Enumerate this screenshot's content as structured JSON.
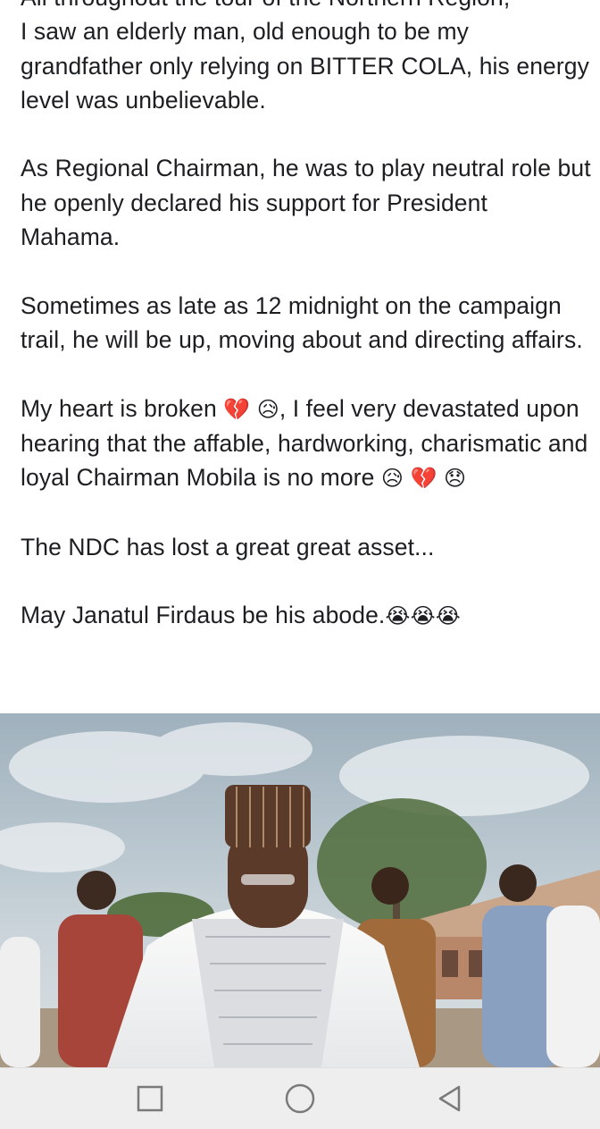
{
  "post": {
    "line_top": "All throughout the tour of the Northern Region,",
    "para1_rest": "I saw an elderly man, old enough to be my grandfather only relying on BITTER COLA, his energy level was unbelievable.",
    "para2": "As Regional Chairman, he was to play neutral role but he openly declared his support for President Mahama.",
    "para3": "Sometimes as late as 12 midnight on the campaign trail, he will be up, moving about and directing affairs.",
    "para4_start": "My heart is broken",
    "para4_mid": ", I feel very devastated upon hearing that the affable, hardworking, charismatic and loyal Chairman Mobila is no more",
    "para5": "The NDC has lost a great great asset...",
    "para6": "May Janatul Firdaus be his abode.",
    "emoji": {
      "broken_heart": "💔",
      "sad_sweat": "😥",
      "pensive": "😞",
      "loud_cry": "😭"
    }
  },
  "photo": {
    "subject": "elderly man in white embroidered smock and striped cap with people standing behind",
    "colors": {
      "sky": "#b8c6cf",
      "robe": "#f4f4f2",
      "cap": "#5a3a28",
      "skin": "#5b3a2a"
    }
  },
  "nav": {
    "recents_icon": "square-icon",
    "home_icon": "circle-icon",
    "back_icon": "triangle-back-icon"
  }
}
